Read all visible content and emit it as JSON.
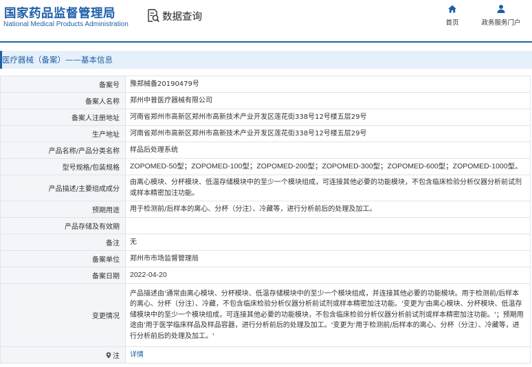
{
  "header": {
    "logo_cn": "国家药品监督管理局",
    "logo_en": "National Medical Products Administration",
    "query_label": "数据查询",
    "query_icon": "search-document-icon",
    "nav": [
      {
        "label": "首页",
        "icon": "home-icon"
      },
      {
        "label": "政务服务门户",
        "icon": "user-icon"
      }
    ]
  },
  "section": {
    "title": "医疗器械（备案）——基本信息"
  },
  "rows": [
    {
      "label": "备案号",
      "value": "豫郑械备20190479号"
    },
    {
      "label": "备案人名称",
      "value": "郑州中普医疗器械有限公司"
    },
    {
      "label": "备案人注册地址",
      "value": "河南省郑州市高新区郑州市高新技术产业开发区莲花街338号12号楼五层29号"
    },
    {
      "label": "生产地址",
      "value": "河南省郑州市高新区郑州市高新技术产业开发区莲花街338号12号楼五层29号"
    },
    {
      "label": "产品名称/产品分类名称",
      "value": "样品后处理系统"
    },
    {
      "label": "型号规格/包装规格",
      "value": "ZOPOMED-50型；ZOPOMED-100型；ZOPOMED-200型；ZOPOMED-300型；ZOPOMED-600型；ZOPOMED-1000型。"
    },
    {
      "label": "产品描述/主要组成成分",
      "value": "由离心模块、分杯模块、低温存储模块中的至少一个模块组成，可连接其他必要的功能模块，不包含临床检验分析仪器分析前试剂或样本精密加注功能。"
    },
    {
      "label": "预期用途",
      "value": "用于检测前/后样本的离心、分杯（分注）、冷藏等，进行分析前后的处理及加工。"
    },
    {
      "label": "产品存储及有效期",
      "value": ""
    },
    {
      "label": "备注",
      "value": "无"
    },
    {
      "label": "备案单位",
      "value": "郑州市市场监督管理局"
    },
    {
      "label": "备案日期",
      "value": "2022-04-20"
    },
    {
      "label": "变更情况",
      "value": "产品描述由'通常由离心模块、分杯模块、低温存储模块中的至少一个模块组成，并连接其他必要的功能模块。用于检测前/后样本的离心、分杯（分注）、冷藏，不包含临床检验分析仪器分析前试剂或样本精密加注功能。'变更为'由离心模块、分杯模块、低温存储模块中的至少一个模块组成，可连接其他必要的功能模块，不包含临床检验分析仪器分析前试剂或样本精密加注功能。'；预期用途由'用于医学临床样品及样品容器，进行分析前后的处理及加工。'变更为'用于检测前/后样本的离心、分杯（分注）、冷藏等，进行分析前后的处理及加工。'"
    },
    {
      "label": "注",
      "value": "详情",
      "icon": "location-pin-icon"
    }
  ],
  "colors": {
    "brand": "#1f5fa8",
    "label_bg": "#f3f5f8",
    "section_bg": "#e6f0fa",
    "border": "#dfe4ea"
  }
}
